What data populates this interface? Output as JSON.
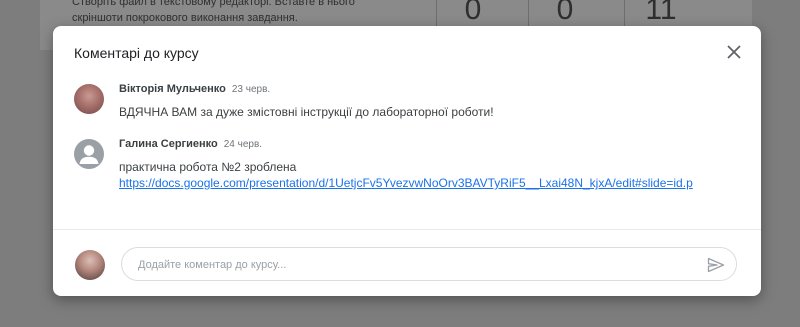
{
  "background": {
    "text": "Створіть файл в текстовому редакторі. Вставте в нього скріншоти покрокового виконання завдання.",
    "stats": [
      "0",
      "0",
      "11"
    ]
  },
  "dialog": {
    "title": "Коментарі до курсу",
    "close_icon": "close-icon",
    "comments": [
      {
        "author": "Вікторія Мульченко",
        "date": "23 черв.",
        "text": "ВДЯЧНА ВАМ за дуже змістовні інструкції до лабораторної роботи!",
        "avatar": "user-photo"
      },
      {
        "author": "Галина Сергиенко",
        "date": "24 черв.",
        "text": "практична робота №2 зроблена",
        "link": "https://docs.google.com/presentation/d/1UetjcFv5YvezvwNoOrv3BAVTyRiF5__Lxai48N_kjxA/edit#slide=id.p",
        "avatar": "person-icon"
      }
    ],
    "composer": {
      "placeholder": "Додайте коментар до курсу...",
      "send_icon": "send-icon"
    }
  }
}
